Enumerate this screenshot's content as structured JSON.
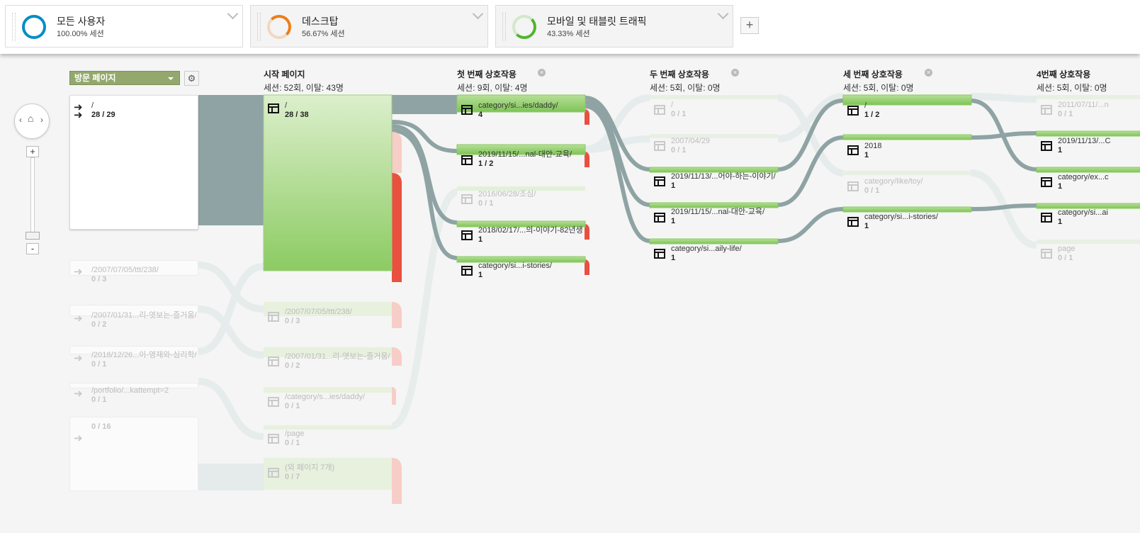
{
  "segments": [
    {
      "name": "모든 사용자",
      "pct": "100.00% 세션",
      "color": "#058dc7",
      "share": 1.0
    },
    {
      "name": "데스크탑",
      "pct": "56.67% 세션",
      "color": "#ed7e17",
      "share": 0.5667
    },
    {
      "name": "모바일 및 태블릿 트래픽",
      "pct": "43.33% 세션",
      "color": "#50b432",
      "share": 0.4333
    }
  ],
  "add_segment": "+",
  "toolbar": {
    "dimension": "방문 페이지",
    "settings_icon": "gear-icon"
  },
  "zoom": {
    "plus": "+",
    "minus": "-",
    "home_left": "‹",
    "home_right": "›"
  },
  "columns": {
    "start": {
      "title": "시작 페이지",
      "sub": "세션: 52회, 이탈: 43명"
    },
    "i1": {
      "title": "첫 번째 상호작용",
      "sub": "세션: 9회, 이탈: 4명"
    },
    "i2": {
      "title": "두 번째 상호작용",
      "sub": "세션: 5회, 이탈: 0명"
    },
    "i3": {
      "title": "세 번째 상호작용",
      "sub": "세션: 5회, 이탈: 0명"
    },
    "i4": {
      "title": "4번째 상호작용",
      "sub": "세션: 5회, 이탈: 0명"
    }
  },
  "landing": [
    {
      "name": "/",
      "val": "28 / 29"
    },
    {
      "name": "/2007/07/05/ttt/238/",
      "val": "0 / 3"
    },
    {
      "name": "/2007/01/31...리-엿보는-즐거움/",
      "val": "0 / 2"
    },
    {
      "name": "/2018/12/26...이-영재와-심리학/",
      "val": "0 / 1"
    },
    {
      "name": "/portfolio/...kattempt=2",
      "val": "0 / 1"
    },
    {
      "name": "",
      "val": "0 / 16"
    }
  ],
  "start_pages": [
    {
      "name": "/",
      "val": "28 / 38"
    },
    {
      "name": "/2007/07/05/ttt/238/",
      "val": "0 / 3"
    },
    {
      "name": "/2007/01/31...리-엿보는-즐거움/",
      "val": "0 / 2"
    },
    {
      "name": "/category/s...ies/daddy/",
      "val": "0 / 1"
    },
    {
      "name": "/page",
      "val": "0 / 1"
    },
    {
      "name": "(외 페이지 7개)",
      "val": "0 / 7"
    }
  ],
  "first": [
    {
      "name": "category/si...ies/daddy/",
      "val": "4"
    },
    {
      "name": "2019/11/15/...nal-대안-교육/",
      "val": "1 / 2"
    },
    {
      "name": "2016/06/28/조심/",
      "val": "0 / 1"
    },
    {
      "name": "2018/02/17/...의-이야기-82년생",
      "val": "1"
    },
    {
      "name": "category/si...i-stories/",
      "val": "1"
    }
  ],
  "second": [
    {
      "name": "/",
      "val": "0 / 1"
    },
    {
      "name": "2007/04/29",
      "val": "0 / 1"
    },
    {
      "name": "2019/11/13/...어야-하는-이야기/",
      "val": "1"
    },
    {
      "name": "2019/11/15/...nal-대안-교육/",
      "val": "1"
    },
    {
      "name": "category/si...aily-life/",
      "val": "1"
    }
  ],
  "third": [
    {
      "name": "/",
      "val": "1 / 2"
    },
    {
      "name": "2018",
      "val": "1"
    },
    {
      "name": "category/like/toy/",
      "val": "0 / 1"
    },
    {
      "name": "category/si...i-stories/",
      "val": "1"
    }
  ],
  "fourth": [
    {
      "name": "2011/07/11/...n",
      "val": "0 / 1"
    },
    {
      "name": "2019/11/13/...C",
      "val": "1"
    },
    {
      "name": "category/ex...c",
      "val": "1"
    },
    {
      "name": "category/si...ai",
      "val": "1"
    },
    {
      "name": "page",
      "val": "0 / 1"
    }
  ]
}
